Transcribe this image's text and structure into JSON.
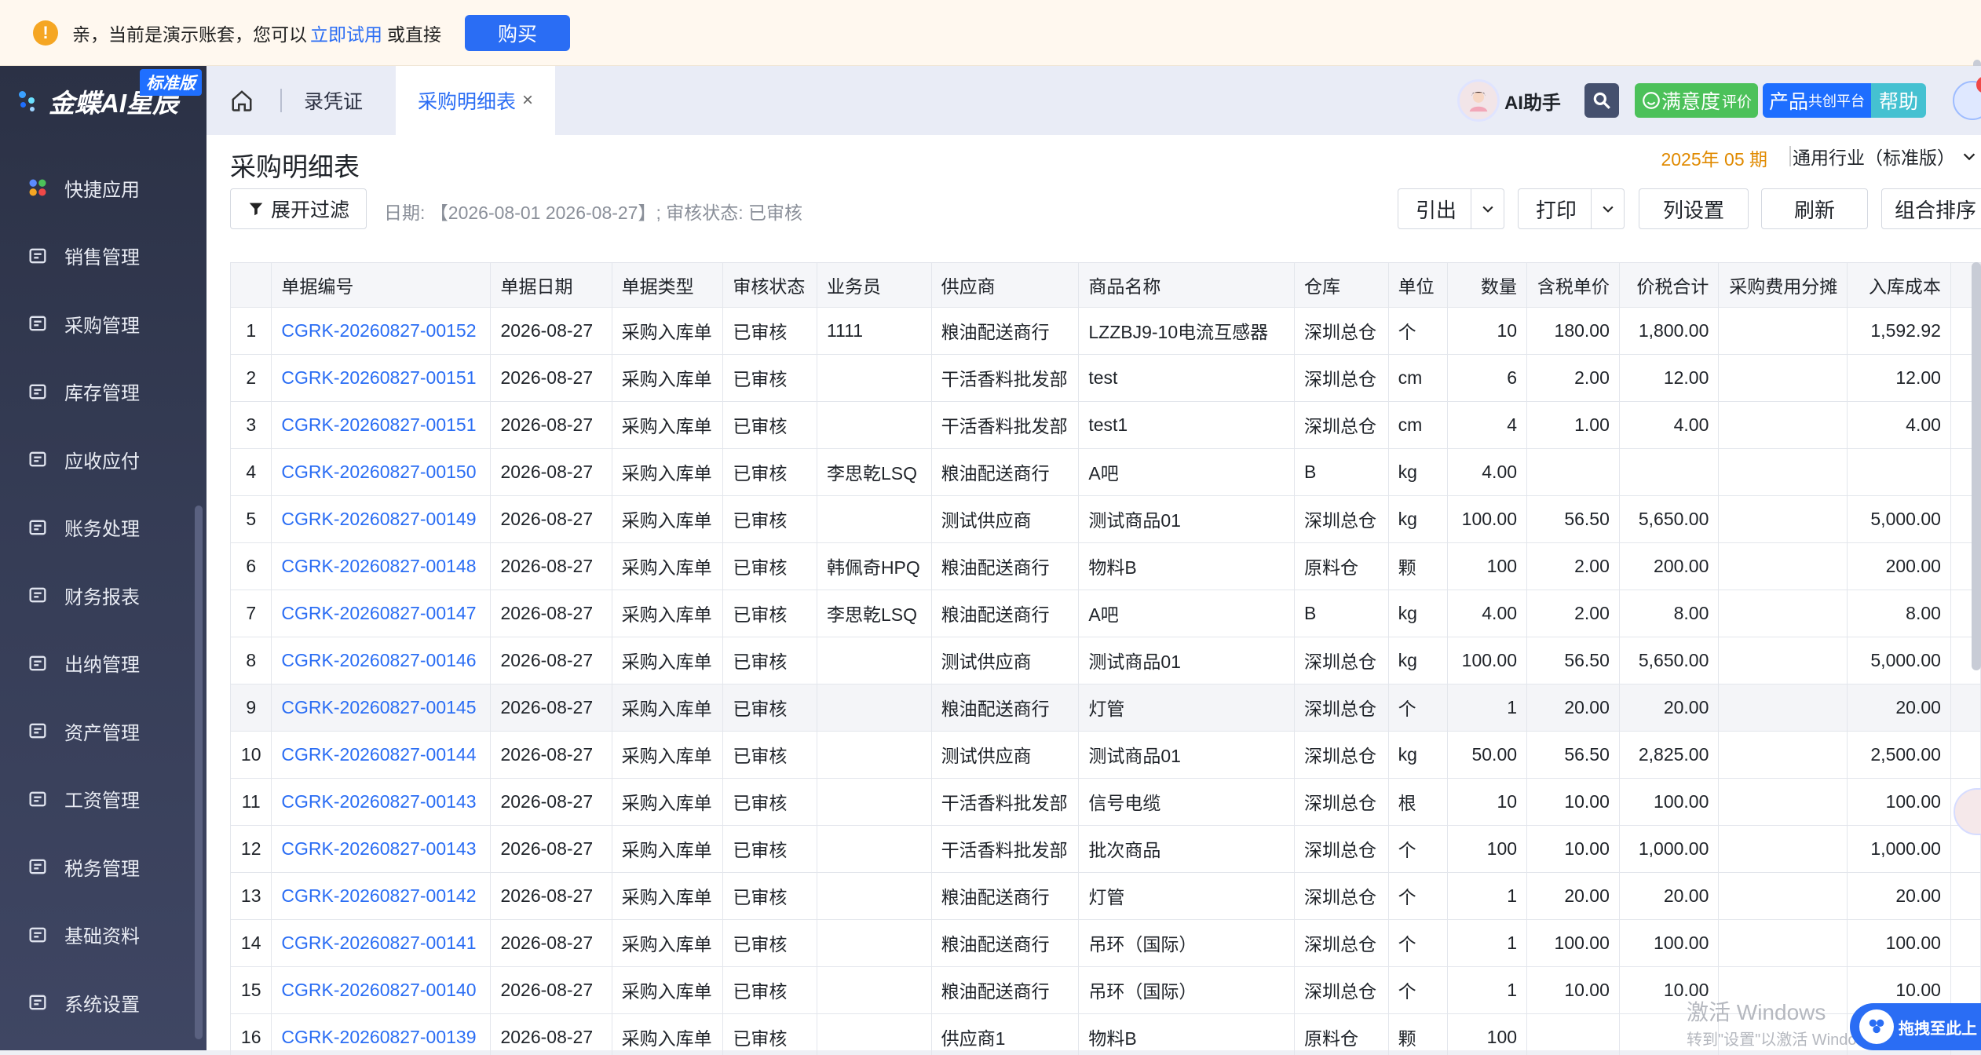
{
  "notice": {
    "text": "亲，当前是演示账套，您可以",
    "trial_link": "立即试用",
    "or_text": "或直接",
    "buy_label": "购买"
  },
  "sidebar": {
    "brand": "金蝶AI星辰",
    "edition": "标准版",
    "items": [
      {
        "label": "快捷应用",
        "icon": "apps-icon"
      },
      {
        "label": "销售管理",
        "icon": "sales-icon"
      },
      {
        "label": "采购管理",
        "icon": "cart-icon"
      },
      {
        "label": "库存管理",
        "icon": "box-icon"
      },
      {
        "label": "应收应付",
        "icon": "receivable-icon"
      },
      {
        "label": "账务处理",
        "icon": "ledger-icon"
      },
      {
        "label": "财务报表",
        "icon": "report-icon"
      },
      {
        "label": "出纳管理",
        "icon": "cashier-icon"
      },
      {
        "label": "资产管理",
        "icon": "asset-icon"
      },
      {
        "label": "工资管理",
        "icon": "payroll-icon"
      },
      {
        "label": "税务管理",
        "icon": "tax-icon"
      },
      {
        "label": "基础资料",
        "icon": "layers-icon"
      },
      {
        "label": "系统设置",
        "icon": "settings-icon"
      }
    ]
  },
  "topbar": {
    "tabs": [
      "录凭证",
      "采购明细表"
    ],
    "close_glyph": "×",
    "ai_label": "AI助手",
    "satisfaction": "满意度",
    "satisfaction_small": "评价",
    "product": "产品",
    "product_small": "共创平台",
    "help": "帮助"
  },
  "page": {
    "title": "采购明细表",
    "period": "2025年 05 期",
    "industry": "通用行业（标准版）",
    "filter_button": "展开过滤",
    "filter_summary": "日期: 【2026-08-01 2026-08-27】; 审核状态: 已审核",
    "toolbar": {
      "export": "引出",
      "print": "打印",
      "columns": "列设置",
      "refresh": "刷新",
      "sort": "组合排序"
    }
  },
  "table": {
    "headers": [
      "",
      "单据编号",
      "单据日期",
      "单据类型",
      "审核状态",
      "业务员",
      "供应商",
      "商品名称",
      "仓库",
      "单位",
      "数量",
      "含税单价",
      "价税合计",
      "采购费用分摊",
      "入库成本"
    ],
    "rows": [
      [
        "1",
        "CGRK-20260827-00152",
        "2026-08-27",
        "采购入库单",
        "已审核",
        "1111",
        "粮油配送商行",
        "LZZBJ9-10电流互感器",
        "深圳总仓",
        "个",
        "10",
        "180.00",
        "1,800.00",
        "",
        "1,592.92"
      ],
      [
        "2",
        "CGRK-20260827-00151",
        "2026-08-27",
        "采购入库单",
        "已审核",
        "",
        "干活香料批发部",
        "test",
        "深圳总仓",
        "cm",
        "6",
        "2.00",
        "12.00",
        "",
        "12.00"
      ],
      [
        "3",
        "CGRK-20260827-00151",
        "2026-08-27",
        "采购入库单",
        "已审核",
        "",
        "干活香料批发部",
        "test1",
        "深圳总仓",
        "cm",
        "4",
        "1.00",
        "4.00",
        "",
        "4.00"
      ],
      [
        "4",
        "CGRK-20260827-00150",
        "2026-08-27",
        "采购入库单",
        "已审核",
        "李思乾LSQ",
        "粮油配送商行",
        "A吧",
        "B",
        "kg",
        "4.00",
        "",
        "",
        "",
        ""
      ],
      [
        "5",
        "CGRK-20260827-00149",
        "2026-08-27",
        "采购入库单",
        "已审核",
        "",
        "测试供应商",
        "测试商品01",
        "深圳总仓",
        "kg",
        "100.00",
        "56.50",
        "5,650.00",
        "",
        "5,000.00"
      ],
      [
        "6",
        "CGRK-20260827-00148",
        "2026-08-27",
        "采购入库单",
        "已审核",
        "韩佩奇HPQ",
        "粮油配送商行",
        "物料B",
        "原料仓",
        "颗",
        "100",
        "2.00",
        "200.00",
        "",
        "200.00"
      ],
      [
        "7",
        "CGRK-20260827-00147",
        "2026-08-27",
        "采购入库单",
        "已审核",
        "李思乾LSQ",
        "粮油配送商行",
        "A吧",
        "B",
        "kg",
        "4.00",
        "2.00",
        "8.00",
        "",
        "8.00"
      ],
      [
        "8",
        "CGRK-20260827-00146",
        "2026-08-27",
        "采购入库单",
        "已审核",
        "",
        "测试供应商",
        "测试商品01",
        "深圳总仓",
        "kg",
        "100.00",
        "56.50",
        "5,650.00",
        "",
        "5,000.00"
      ],
      [
        "9",
        "CGRK-20260827-00145",
        "2026-08-27",
        "采购入库单",
        "已审核",
        "",
        "粮油配送商行",
        "灯管",
        "深圳总仓",
        "个",
        "1",
        "20.00",
        "20.00",
        "",
        "20.00"
      ],
      [
        "10",
        "CGRK-20260827-00144",
        "2026-08-27",
        "采购入库单",
        "已审核",
        "",
        "测试供应商",
        "测试商品01",
        "深圳总仓",
        "kg",
        "50.00",
        "56.50",
        "2,825.00",
        "",
        "2,500.00"
      ],
      [
        "11",
        "CGRK-20260827-00143",
        "2026-08-27",
        "采购入库单",
        "已审核",
        "",
        "干活香料批发部",
        "信号电缆",
        "深圳总仓",
        "根",
        "10",
        "10.00",
        "100.00",
        "",
        "100.00"
      ],
      [
        "12",
        "CGRK-20260827-00143",
        "2026-08-27",
        "采购入库单",
        "已审核",
        "",
        "干活香料批发部",
        "批次商品",
        "深圳总仓",
        "个",
        "100",
        "10.00",
        "1,000.00",
        "",
        "1,000.00"
      ],
      [
        "13",
        "CGRK-20260827-00142",
        "2026-08-27",
        "采购入库单",
        "已审核",
        "",
        "粮油配送商行",
        "灯管",
        "深圳总仓",
        "个",
        "1",
        "20.00",
        "20.00",
        "",
        "20.00"
      ],
      [
        "14",
        "CGRK-20260827-00141",
        "2026-08-27",
        "采购入库单",
        "已审核",
        "",
        "粮油配送商行",
        "吊环（国际）",
        "深圳总仓",
        "个",
        "1",
        "100.00",
        "100.00",
        "",
        "100.00"
      ],
      [
        "15",
        "CGRK-20260827-00140",
        "2026-08-27",
        "采购入库单",
        "已审核",
        "",
        "粮油配送商行",
        "吊环（国际）",
        "深圳总仓",
        "个",
        "1",
        "10.00",
        "10.00",
        "",
        "10.00"
      ],
      [
        "16",
        "CGRK-20260827-00139",
        "2026-08-27",
        "采购入库单",
        "已审核",
        "",
        "供应商1",
        "物料B",
        "原料仓",
        "颗",
        "100",
        "",
        "",
        "",
        ""
      ]
    ],
    "highlighted_row": 9
  },
  "overlay": {
    "watermark": "激活 Windows",
    "watermark_sub": "转到\"设置\"以激活 Windows。",
    "drag_tip": "拖拽至此上"
  },
  "colors": {
    "accent": "#2a6df4",
    "sidebar": "#2b3145",
    "period": "#e08a00",
    "satisfaction": "#4cc15a",
    "help": "#45c1d1"
  }
}
